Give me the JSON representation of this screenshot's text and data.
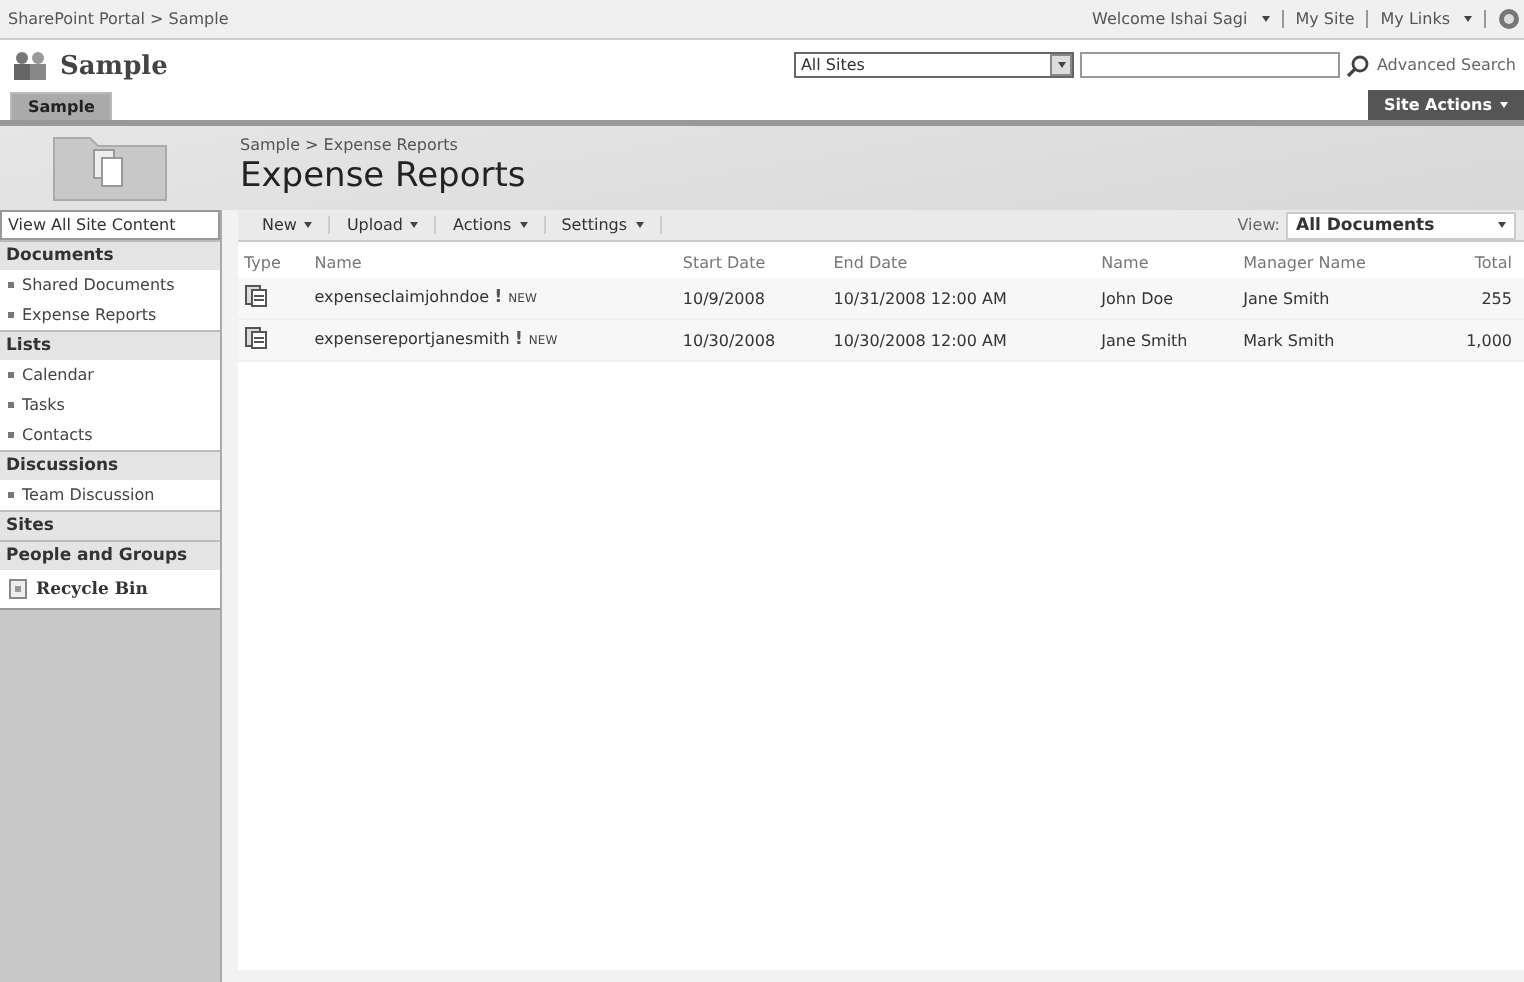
{
  "top_bar": {
    "breadcrumb": "SharePoint Portal > Sample",
    "welcome": "Welcome Ishai Sagi",
    "links": [
      "My Site",
      "My Links"
    ]
  },
  "header": {
    "site_title": "Sample",
    "tabs": [
      {
        "label": "Sample",
        "selected": true
      }
    ],
    "scope": "All Sites",
    "advanced_search": "Advanced Search",
    "site_actions": "Site Actions"
  },
  "page": {
    "breadcrumb": "Sample > Expense Reports",
    "title": "Expense Reports"
  },
  "sidebar": {
    "items": [
      {
        "kind": "link",
        "label": "View All Site Content"
      },
      {
        "kind": "heading",
        "label": "Documents"
      },
      {
        "kind": "item",
        "label": "Shared Documents"
      },
      {
        "kind": "item",
        "label": "Expense Reports"
      },
      {
        "kind": "heading",
        "label": "Lists"
      },
      {
        "kind": "item",
        "label": "Calendar"
      },
      {
        "kind": "item",
        "label": "Tasks"
      },
      {
        "kind": "item",
        "label": "Contacts"
      },
      {
        "kind": "heading",
        "label": "Discussions"
      },
      {
        "kind": "item",
        "label": "Team Discussion"
      },
      {
        "kind": "heading",
        "label": "Sites"
      },
      {
        "kind": "heading",
        "label": "People and Groups"
      },
      {
        "kind": "recycle",
        "label": "Recycle Bin"
      }
    ]
  },
  "toolbar": {
    "menus": [
      "New",
      "Upload",
      "Actions",
      "Settings"
    ],
    "view_label": "View:",
    "view": "All Documents"
  },
  "table": {
    "columns": [
      "Type",
      "Name",
      "Start Date",
      "End Date",
      "Name",
      "Manager Name",
      "Total"
    ],
    "rows": [
      {
        "name": "expenseclaimjohndoe",
        "flag": "!",
        "badge": "NEW",
        "start": "10/9/2008",
        "end": "10/31/2008 12:00 AM",
        "person": "John Doe",
        "manager": "Jane Smith",
        "total": "255"
      },
      {
        "name": "expensereportjanesmith",
        "flag": "!",
        "badge": "NEW",
        "start": "10/30/2008",
        "end": "10/30/2008 12:00 AM",
        "person": "Jane Smith",
        "manager": "Mark Smith",
        "total": "1,000"
      }
    ]
  }
}
